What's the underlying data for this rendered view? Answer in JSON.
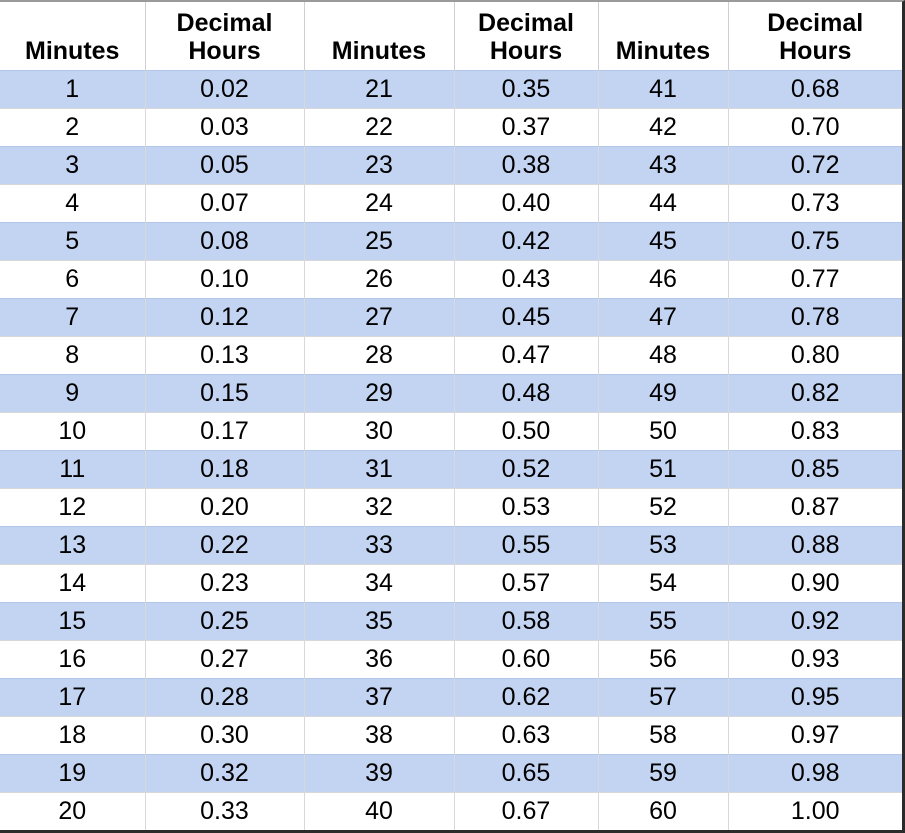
{
  "table": {
    "headers": [
      "Minutes",
      "Decimal Hours",
      "Minutes",
      "Decimal Hours",
      "Minutes",
      "Decimal Hours"
    ],
    "highlight_color": "#c3d3f2",
    "row_color": "#ffffff",
    "border_color": "#2b2b2b",
    "grid_color": "#d8d8d8",
    "rows": [
      [
        "1",
        "0.02",
        "21",
        "0.35",
        "41",
        "0.68"
      ],
      [
        "2",
        "0.03",
        "22",
        "0.37",
        "42",
        "0.70"
      ],
      [
        "3",
        "0.05",
        "23",
        "0.38",
        "43",
        "0.72"
      ],
      [
        "4",
        "0.07",
        "24",
        "0.40",
        "44",
        "0.73"
      ],
      [
        "5",
        "0.08",
        "25",
        "0.42",
        "45",
        "0.75"
      ],
      [
        "6",
        "0.10",
        "26",
        "0.43",
        "46",
        "0.77"
      ],
      [
        "7",
        "0.12",
        "27",
        "0.45",
        "47",
        "0.78"
      ],
      [
        "8",
        "0.13",
        "28",
        "0.47",
        "48",
        "0.80"
      ],
      [
        "9",
        "0.15",
        "29",
        "0.48",
        "49",
        "0.82"
      ],
      [
        "10",
        "0.17",
        "30",
        "0.50",
        "50",
        "0.83"
      ],
      [
        "11",
        "0.18",
        "31",
        "0.52",
        "51",
        "0.85"
      ],
      [
        "12",
        "0.20",
        "32",
        "0.53",
        "52",
        "0.87"
      ],
      [
        "13",
        "0.22",
        "33",
        "0.55",
        "53",
        "0.88"
      ],
      [
        "14",
        "0.23",
        "34",
        "0.57",
        "54",
        "0.90"
      ],
      [
        "15",
        "0.25",
        "35",
        "0.58",
        "55",
        "0.92"
      ],
      [
        "16",
        "0.27",
        "36",
        "0.60",
        "56",
        "0.93"
      ],
      [
        "17",
        "0.28",
        "37",
        "0.62",
        "57",
        "0.95"
      ],
      [
        "18",
        "0.30",
        "38",
        "0.63",
        "58",
        "0.97"
      ],
      [
        "19",
        "0.32",
        "39",
        "0.65",
        "59",
        "0.98"
      ],
      [
        "20",
        "0.33",
        "40",
        "0.67",
        "60",
        "1.00"
      ]
    ]
  }
}
